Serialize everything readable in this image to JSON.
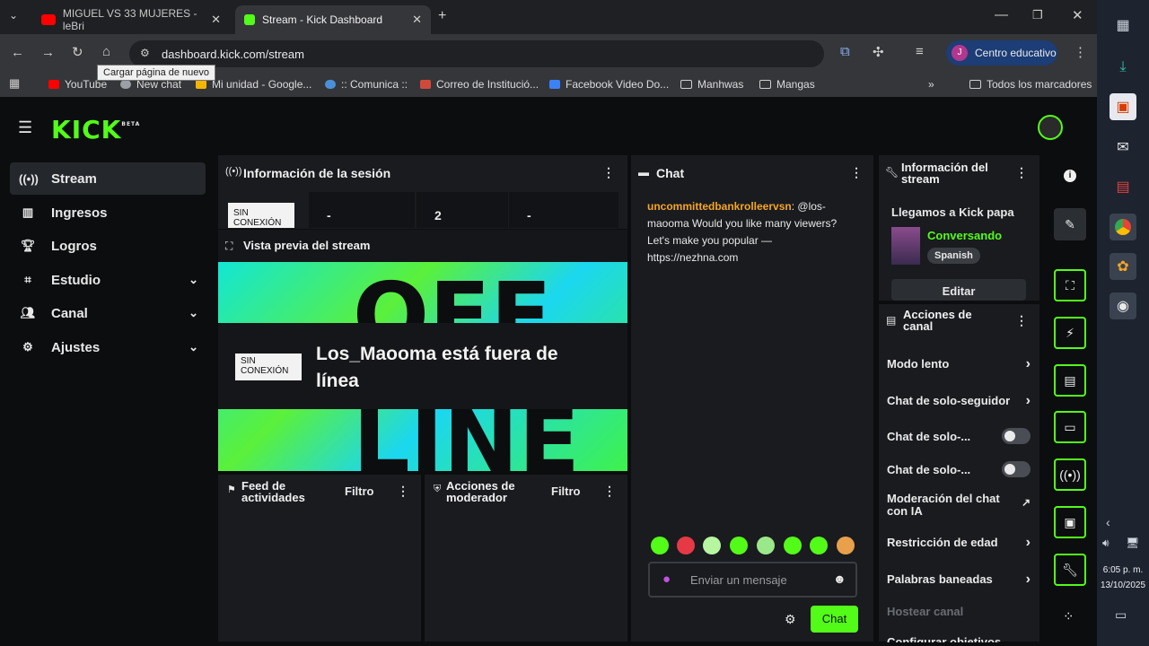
{
  "browser": {
    "tabs": [
      {
        "title": "MIGUEL VS 33 MUJERES - leBri"
      },
      {
        "title": "Stream - Kick Dashboard"
      }
    ],
    "url": "dashboard.kick.com/stream",
    "tooltip": "Cargar página de nuevo",
    "profile_label": "Centro educativo",
    "profile_initial": "J",
    "bookmarks": [
      "YouTube",
      "New chat",
      "Mi unidad - Google...",
      ":: Comunica ::",
      "Correo de Institució...",
      "Facebook Video Do...",
      "Manhwas",
      "Mangas"
    ],
    "all_bookmarks": "Todos los marcadores"
  },
  "app": {
    "logo": "KICK",
    "logo_badge": "BETA",
    "sidebar": [
      {
        "label": "Stream",
        "icon": "stream-icon"
      },
      {
        "label": "Ingresos",
        "icon": "chart-icon"
      },
      {
        "label": "Logros",
        "icon": "trophy-icon"
      },
      {
        "label": "Estudio",
        "icon": "studio-icon"
      },
      {
        "label": "Canal",
        "icon": "users-icon"
      },
      {
        "label": "Ajustes",
        "icon": "gear-icon"
      }
    ],
    "session": {
      "title": "Información de la sesión",
      "status": "SIN CONEXIÓN",
      "stats": [
        "-",
        "2",
        "-"
      ]
    },
    "preview": {
      "title": "Vista previa del stream",
      "badge_line1": "SIN",
      "badge_line2": "CONEXIÓN",
      "offline_text": "Los_Maooma está fuera de línea",
      "bg_top": "OFF",
      "bg_bottom": "LINE"
    },
    "feed": {
      "title": "Feed de actividades",
      "filter": "Filtro"
    },
    "mod_actions": {
      "title": "Acciones de moderador",
      "filter": "Filtro"
    },
    "chat": {
      "title": "Chat",
      "message_user": "uncommittedbankrolleervsn",
      "message_text": ": @los-maooma Would you like many viewers? Let's make you popular — https://nezhna.com",
      "placeholder": "Enviar un mensaje",
      "send_label": "Chat"
    },
    "stream_info": {
      "title": "Información del stream",
      "stream_title": "Llegamos a Kick papa",
      "category": "Conversando",
      "language": "Spanish",
      "edit_label": "Editar"
    },
    "channel_actions": {
      "title": "Acciones de canal",
      "items": [
        {
          "label": "Modo lento",
          "type": "arrow"
        },
        {
          "label": "Chat de solo-seguidor",
          "type": "arrow"
        },
        {
          "label": "Chat de solo-...",
          "type": "toggle"
        },
        {
          "label": "Chat de solo-...",
          "type": "toggle"
        },
        {
          "label": "Moderación del chat con IA",
          "type": "external"
        },
        {
          "label": "Restricción de edad",
          "type": "arrow"
        },
        {
          "label": "Palabras baneadas",
          "type": "arrow"
        },
        {
          "label": "Hostear canal",
          "type": "disabled"
        },
        {
          "label": "Configurar objetivos",
          "type": "arrow"
        }
      ]
    }
  },
  "taskbar": {
    "time": "6:05 p. m.",
    "date": "13/10/2025"
  },
  "colors": {
    "kick_green": "#53fc18",
    "panel_bg": "#191b1f",
    "username": "#f5a623",
    "category": "#53fc18"
  }
}
